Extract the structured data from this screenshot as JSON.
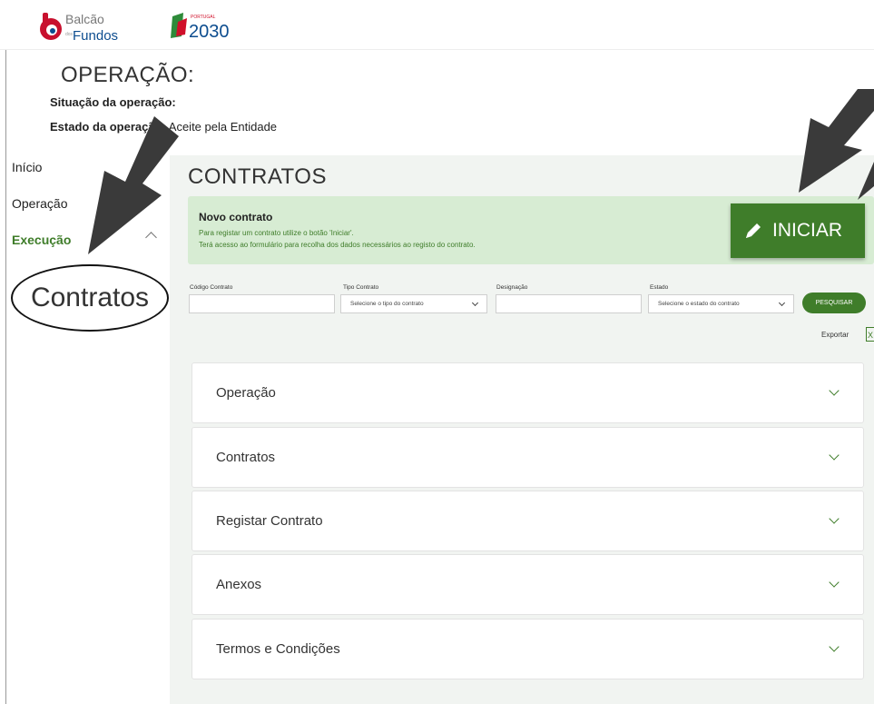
{
  "header": {
    "logo_balcao_line1": "Balcão",
    "logo_balcao_small": "dos",
    "logo_balcao_line2": "Fundos",
    "logo_pt_small": "PORTUGAL",
    "logo_pt_year": "2030"
  },
  "operation": {
    "title": "OPERAÇÃO:",
    "situacao_label": "Situação da operação:",
    "estado_label": "Estado da operação:",
    "estado_value": "Aceite pela Entidade"
  },
  "sidebar": {
    "items": [
      {
        "label": "Início"
      },
      {
        "label": "Operação"
      },
      {
        "label": "Execução"
      }
    ],
    "highlight_label": "Contratos"
  },
  "main": {
    "title": "CONTRATOS",
    "info": {
      "title": "Novo contrato",
      "line1": "Para registar um contrato utilize o botão 'Iniciar'.",
      "line2": "Terá acesso ao formulário para recolha dos dados necessários ao registo do contrato."
    },
    "iniciar_label": "INICIAR",
    "filters": {
      "codigo_label": "Código Contrato",
      "tipo_label": "Tipo Contrato",
      "tipo_placeholder": "Selecione o tipo do contrato",
      "designacao_label": "Designação",
      "estado_label": "Estado",
      "estado_placeholder": "Selecione o estado do contrato",
      "pesquisar_label": "PESQUISAR"
    },
    "exportar_label": "Exportar",
    "accordion": [
      {
        "label": "Operação"
      },
      {
        "label": "Contratos"
      },
      {
        "label": "Registar Contrato"
      },
      {
        "label": "Anexos"
      },
      {
        "label": "Termos e Condições"
      }
    ]
  },
  "colors": {
    "brand_green": "#3f7d2a",
    "info_bg": "#d7ecd3",
    "panel_bg": "#f1f4f1"
  },
  "icons": [
    "pencil-icon",
    "chevron-down-icon",
    "chevron-up-icon",
    "excel-icon"
  ]
}
